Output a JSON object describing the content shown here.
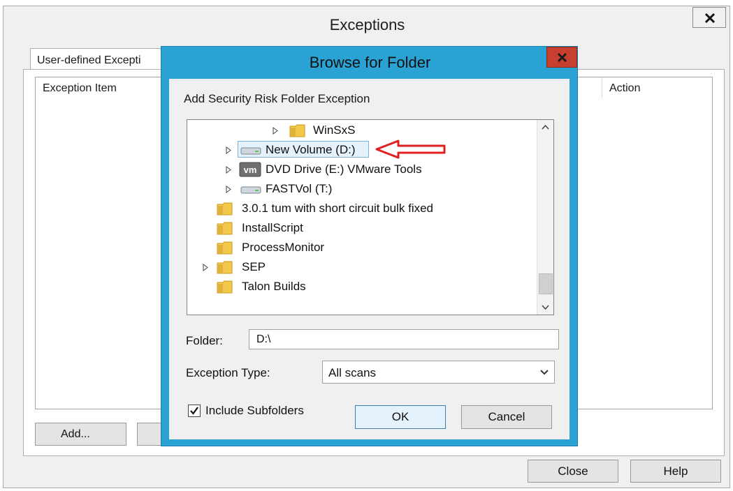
{
  "exceptions_window": {
    "title": "Exceptions",
    "tab_label": "User-defined Excepti",
    "columns": [
      "Exception Item",
      "Action"
    ],
    "add_button": "Add...",
    "close_button": "Close",
    "help_button": "Help"
  },
  "browse_dialog": {
    "title": "Browse for Folder",
    "description": "Add Security Risk Folder Exception",
    "tree_items": [
      {
        "label": "WinSxS",
        "icon": "folder-icon",
        "expandable": true
      },
      {
        "label": "New Volume (D:)",
        "icon": "drive-icon",
        "expandable": true,
        "selected": true
      },
      {
        "label": "DVD Drive (E:) VMware Tools",
        "icon": "vmware-icon",
        "expandable": true
      },
      {
        "label": "FASTVol (T:)",
        "icon": "drive-icon",
        "expandable": true
      },
      {
        "label": "3.0.1 tum with short circuit bulk fixed",
        "icon": "folder-icon",
        "expandable": false
      },
      {
        "label": "InstallScript",
        "icon": "folder-icon",
        "expandable": false
      },
      {
        "label": "ProcessMonitor",
        "icon": "folder-icon",
        "expandable": false
      },
      {
        "label": "SEP",
        "icon": "folder-icon",
        "expandable": true
      },
      {
        "label": "Talon Builds",
        "icon": "folder-icon",
        "expandable": false
      }
    ],
    "vmware_badge": "vm",
    "folder_label": "Folder:",
    "folder_value": "D:\\",
    "exception_type_label": "Exception Type:",
    "exception_type_value": "All scans",
    "include_subfolders_label": "Include Subfolders",
    "include_subfolders_checked": true,
    "ok_button": "OK",
    "cancel_button": "Cancel"
  },
  "colors": {
    "dialog_frame": "#2aa2d4",
    "dialog_close": "#c7402f",
    "annotation_arrow": "#e02020",
    "folder_yellow": "#f2c94c"
  }
}
